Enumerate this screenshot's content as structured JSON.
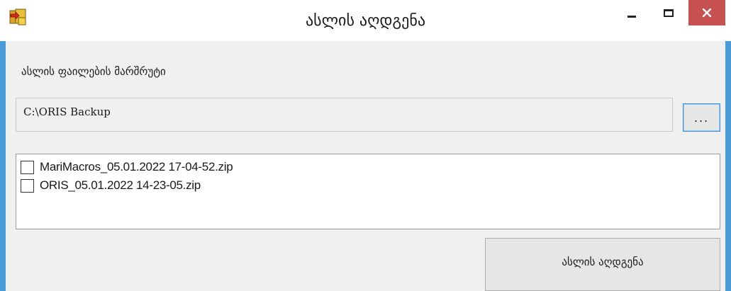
{
  "window": {
    "title": "ასლის აღდგენა",
    "icon": "backup-restore-icon",
    "close_color": "#c75050",
    "frame_color": "#4a9bd8"
  },
  "form": {
    "path_caption": "ასლის ფაილების მარშრუტი",
    "path_value": "C:\\ORIS Backup",
    "browse_label": "..."
  },
  "files": [
    {
      "name": "MariMacros_05.01.2022 17-04-52.zip",
      "checked": false
    },
    {
      "name": "ORIS_05.01.2022 14-23-05.zip",
      "checked": false
    }
  ],
  "actions": {
    "restore_label": "ასლის აღდგენა"
  }
}
